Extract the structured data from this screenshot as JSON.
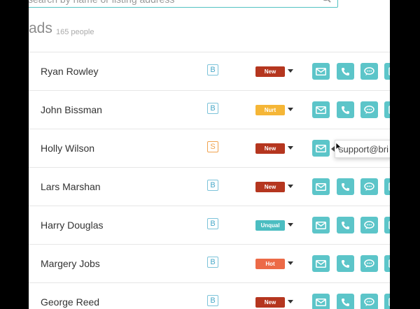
{
  "search": {
    "placeholder": "search by name or listing address"
  },
  "header": {
    "title": "ads",
    "count": "165 people"
  },
  "leads": [
    {
      "name": "Ryan Rowley",
      "type": "B",
      "status": "New"
    },
    {
      "name": "John Bissman",
      "type": "B",
      "status": "Nurt"
    },
    {
      "name": "Holly Wilson",
      "type": "S",
      "status": "New"
    },
    {
      "name": "Lars Marshan",
      "type": "B",
      "status": "New"
    },
    {
      "name": "Harry Douglas",
      "type": "B",
      "status": "Unqual"
    },
    {
      "name": "Margery Jobs",
      "type": "B",
      "status": "Hot"
    },
    {
      "name": "George Reed",
      "type": "B",
      "status": "New"
    }
  ],
  "status_colors": {
    "New": "#b5361f",
    "Nurt": "#f5b637",
    "Unqual": "#4bbdc1",
    "Hot": "#ec6a47"
  },
  "accent_color": "#5cc5c9",
  "row_actions": [
    "email-icon",
    "phone-icon",
    "chat-icon",
    "more-icon"
  ],
  "tooltip": {
    "text": "support@bri"
  }
}
